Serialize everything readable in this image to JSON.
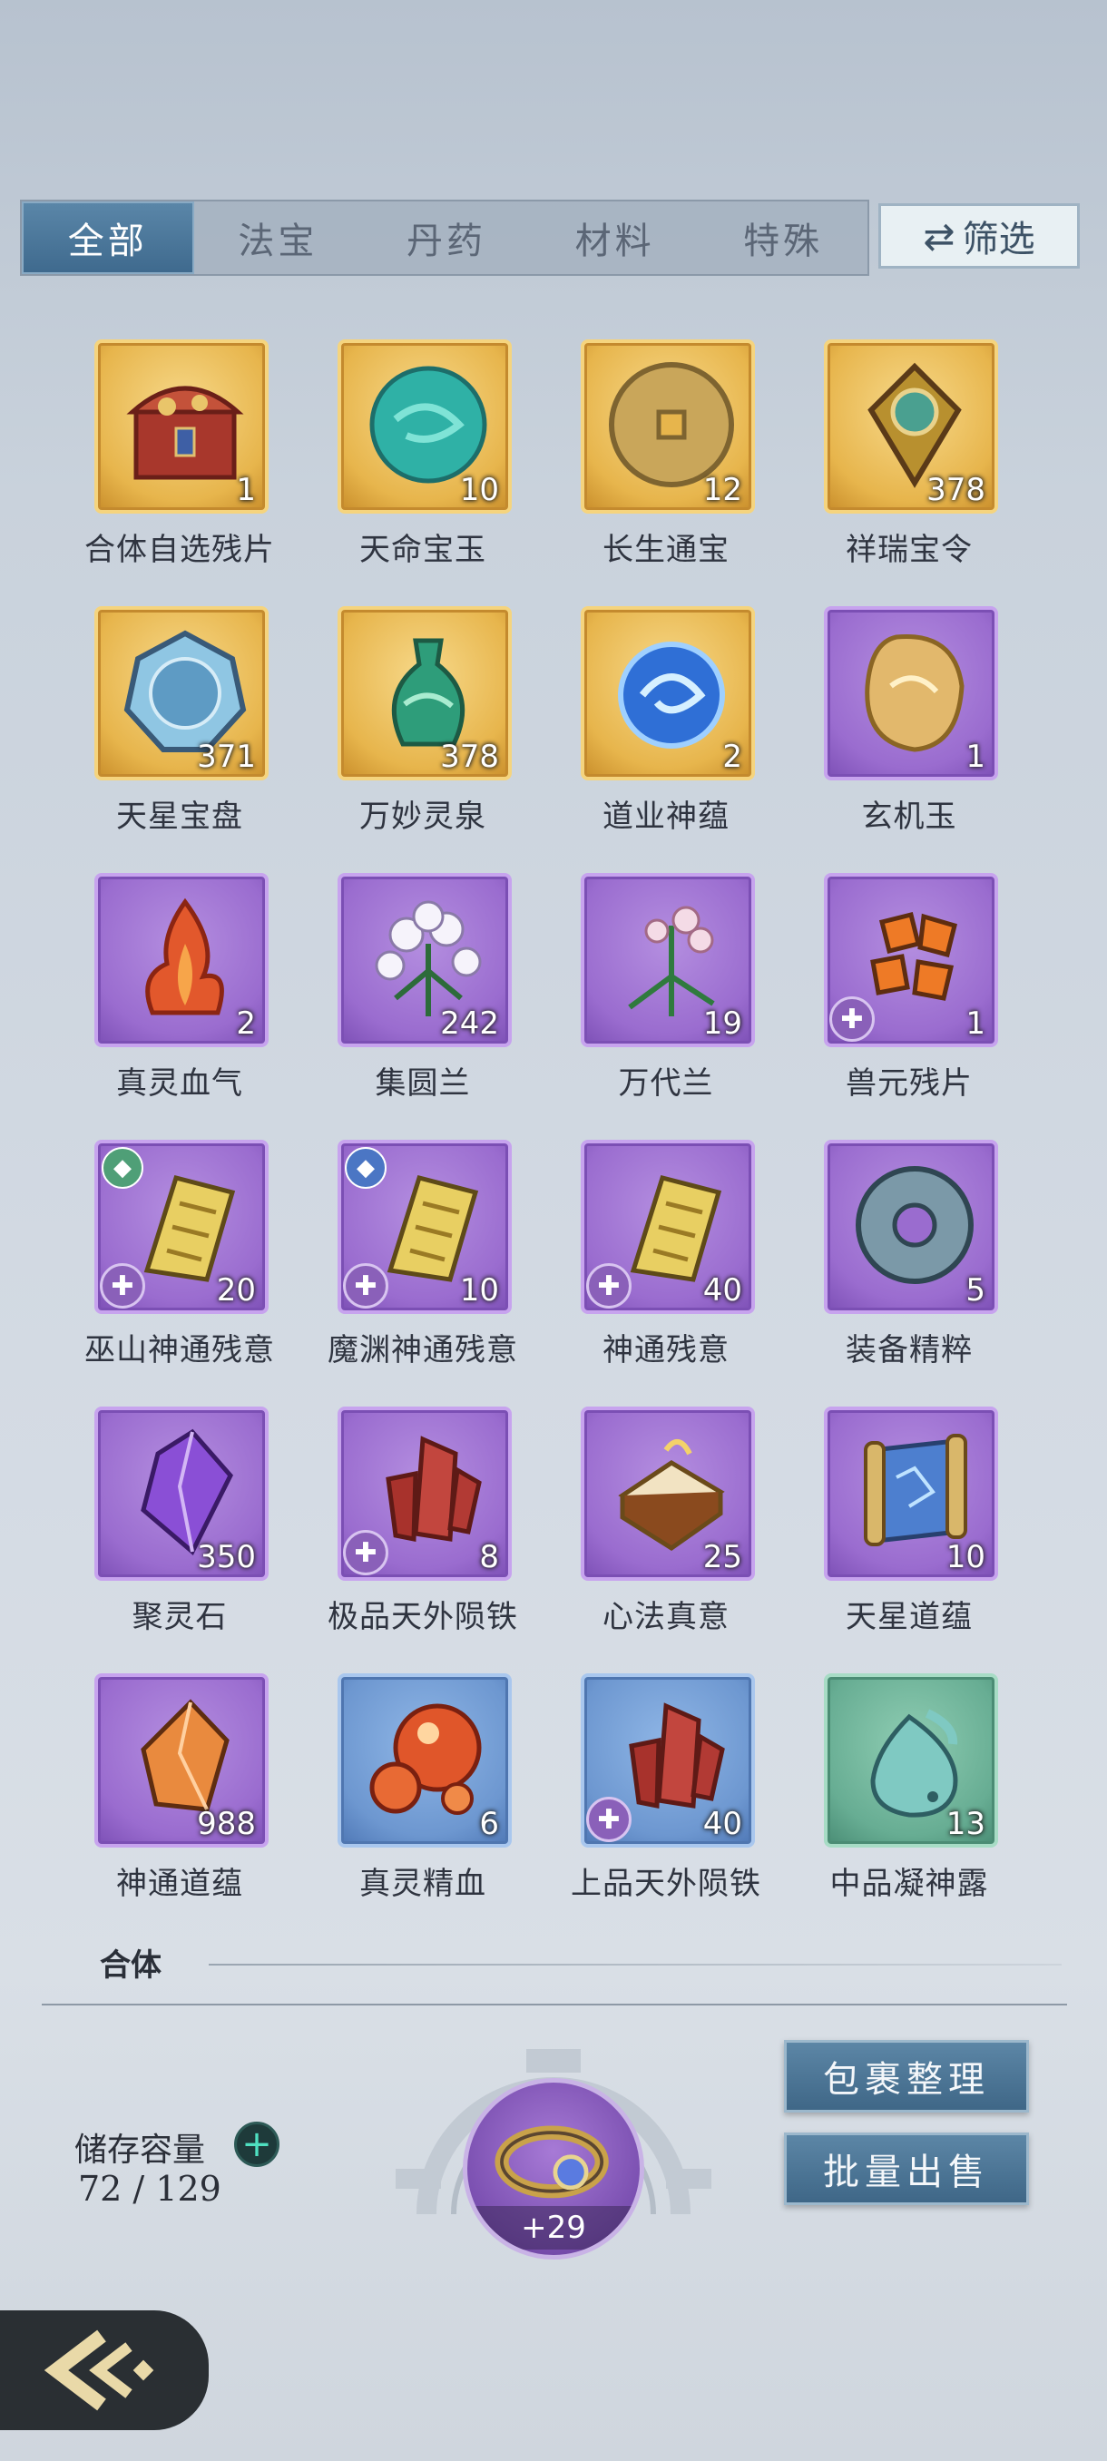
{
  "tabs": [
    {
      "label": "全部",
      "active": true
    },
    {
      "label": "法宝",
      "active": false
    },
    {
      "label": "丹药",
      "active": false
    },
    {
      "label": "材料",
      "active": false
    },
    {
      "label": "特殊",
      "active": false
    }
  ],
  "filter": {
    "label": "筛选",
    "icon": "swap-arrows-icon"
  },
  "items": [
    {
      "name": "合体自选残片",
      "count": "1",
      "rarity": "gold",
      "icon": "treasure-chest-icon"
    },
    {
      "name": "天命宝玉",
      "count": "10",
      "rarity": "gold",
      "icon": "jade-orb-icon"
    },
    {
      "name": "长生通宝",
      "count": "12",
      "rarity": "gold",
      "icon": "coin-icon"
    },
    {
      "name": "祥瑞宝令",
      "count": "378",
      "rarity": "gold",
      "icon": "token-icon"
    },
    {
      "name": "天星宝盘",
      "count": "371",
      "rarity": "gold",
      "icon": "star-plate-icon"
    },
    {
      "name": "万妙灵泉",
      "count": "378",
      "rarity": "gold",
      "icon": "vase-icon"
    },
    {
      "name": "道业神蕴",
      "count": "2",
      "rarity": "gold",
      "icon": "blue-swirl-icon"
    },
    {
      "name": "玄机玉",
      "count": "1",
      "rarity": "purple",
      "icon": "amber-stone-icon"
    },
    {
      "name": "真灵血气",
      "count": "2",
      "rarity": "purple",
      "icon": "flame-icon"
    },
    {
      "name": "集圆兰",
      "count": "242",
      "rarity": "purple",
      "icon": "white-orchid-icon"
    },
    {
      "name": "万代兰",
      "count": "19",
      "rarity": "purple",
      "icon": "pink-orchid-icon"
    },
    {
      "name": "兽元残片",
      "count": "1",
      "rarity": "purple",
      "icon": "orange-shards-icon",
      "fragment": true
    },
    {
      "name": "巫山神通残意",
      "count": "20",
      "rarity": "purple",
      "icon": "gold-scroll-icon",
      "fragment": true,
      "top_badge": "green"
    },
    {
      "name": "魔渊神通残意",
      "count": "10",
      "rarity": "purple",
      "icon": "gold-scroll-icon",
      "fragment": true,
      "top_badge": "blue"
    },
    {
      "name": "神通残意",
      "count": "40",
      "rarity": "purple",
      "icon": "gold-scroll-icon",
      "fragment": true
    },
    {
      "name": "装备精粹",
      "count": "5",
      "rarity": "purple",
      "icon": "stone-ring-icon"
    },
    {
      "name": "聚灵石",
      "count": "350",
      "rarity": "purple",
      "icon": "purple-crystal-icon"
    },
    {
      "name": "极品天外陨铁",
      "count": "8",
      "rarity": "purple",
      "icon": "red-crystal-icon",
      "fragment": true
    },
    {
      "name": "心法真意",
      "count": "25",
      "rarity": "purple",
      "icon": "golden-book-icon"
    },
    {
      "name": "天星道蕴",
      "count": "10",
      "rarity": "purple",
      "icon": "blue-scroll-icon"
    },
    {
      "name": "神通道蕴",
      "count": "988",
      "rarity": "purple",
      "icon": "orange-crystal-icon"
    },
    {
      "name": "真灵精血",
      "count": "6",
      "rarity": "blue",
      "icon": "red-orbs-icon"
    },
    {
      "name": "上品天外陨铁",
      "count": "40",
      "rarity": "blue",
      "icon": "red-crystal-icon",
      "fragment": true
    },
    {
      "name": "中品凝神露",
      "count": "13",
      "rarity": "green",
      "icon": "dew-drop-icon"
    }
  ],
  "section": {
    "label": "合体"
  },
  "storage": {
    "label": "储存容量",
    "value": "72 / 129"
  },
  "ring": {
    "count": "+29",
    "icon": "ring-icon"
  },
  "actions": {
    "organize": "包裹整理",
    "bulk_sell": "批量出售"
  },
  "back": {
    "icon": "back-arrow-icon"
  }
}
